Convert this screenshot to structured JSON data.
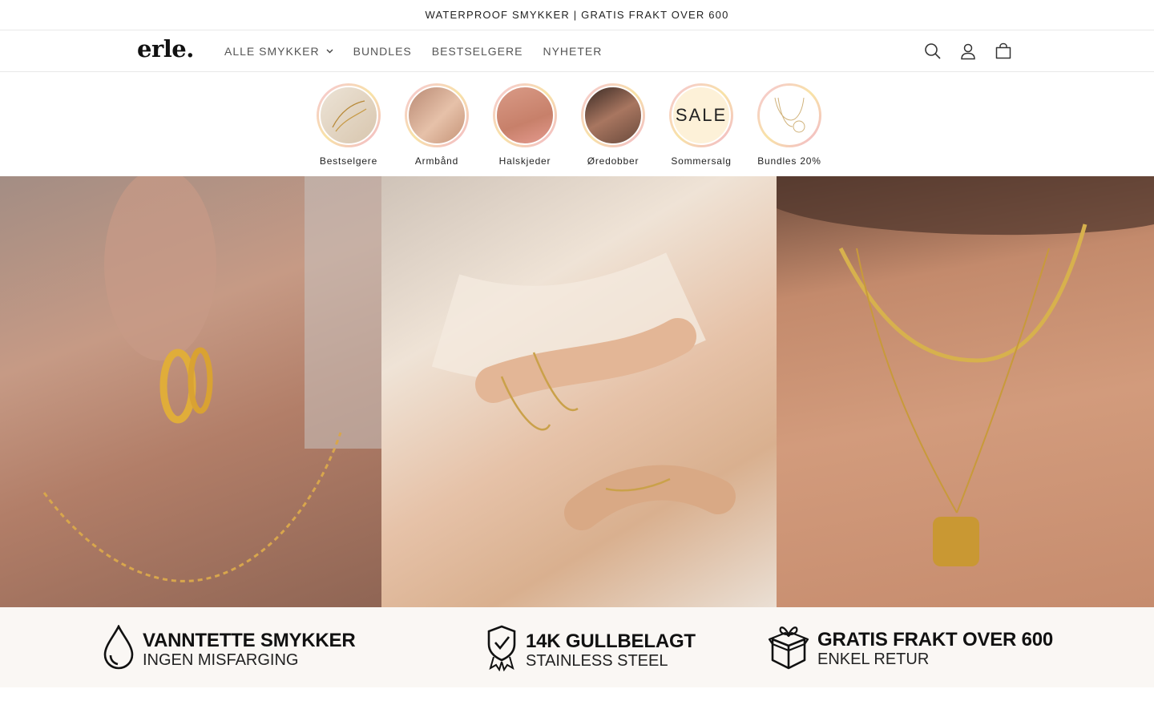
{
  "announcement": {
    "text": "WATERPROOF SMYKKER | GRATIS FRAKT OVER 600"
  },
  "header": {
    "logo": "erle.",
    "nav": [
      {
        "label": "ALLE SMYKKER",
        "has_dropdown": true
      },
      {
        "label": "BUNDLES"
      },
      {
        "label": "BESTSELGERE"
      },
      {
        "label": "NYHETER"
      }
    ],
    "icons": [
      "search-icon",
      "account-icon",
      "cart-icon"
    ]
  },
  "categories": [
    {
      "label": "Bestselgere"
    },
    {
      "label": "Armbånd"
    },
    {
      "label": "Halskjeder"
    },
    {
      "label": "Øredobber"
    },
    {
      "label": "Sommersalg",
      "badge": "SALE"
    },
    {
      "label": "Bundles 20%"
    }
  ],
  "hero": {
    "panels": [
      "earring-necklace-photo",
      "bracelets-photo",
      "necklaces-photo"
    ]
  },
  "features": [
    {
      "icon": "water-drop-icon",
      "title": "VANNTETTE SMYKKER",
      "subtitle": "INGEN MISFARGING"
    },
    {
      "icon": "shield-check-icon",
      "title": "14K GULLBELAGT",
      "subtitle": "STAINLESS STEEL"
    },
    {
      "icon": "gift-box-icon",
      "title": "GRATIS FRAKT OVER 600",
      "subtitle": "ENKEL RETUR"
    }
  ],
  "colors": {
    "accent_ring_pink": "#f5c3d6",
    "accent_ring_gold": "#f8e3a6",
    "feature_bg": "#faf7f4"
  }
}
